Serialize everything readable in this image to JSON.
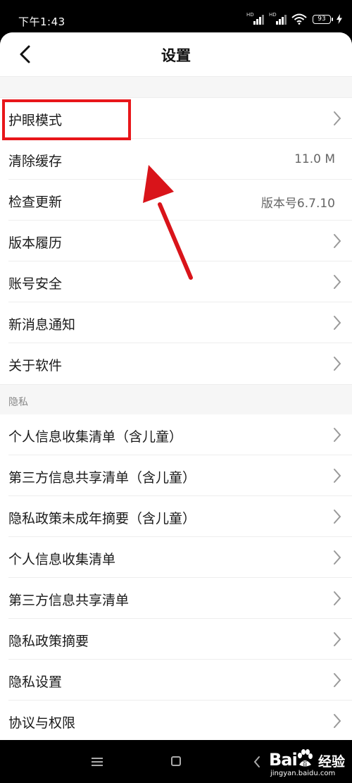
{
  "status_bar": {
    "time": "下午1:43",
    "battery": "93",
    "hd1": "HD",
    "hd2": "HD"
  },
  "header": {
    "title": "设置"
  },
  "settings": [
    {
      "label": "护眼模式",
      "value": ""
    },
    {
      "label": "清除缓存",
      "value": "11.0 M"
    },
    {
      "label": "检查更新",
      "value": "版本号6.7.10"
    },
    {
      "label": "版本履历",
      "value": ""
    },
    {
      "label": "账号安全",
      "value": ""
    },
    {
      "label": "新消息通知",
      "value": ""
    },
    {
      "label": "关于软件",
      "value": ""
    }
  ],
  "privacy": {
    "section_title": "隐私",
    "items": [
      {
        "label": "个人信息收集清单（含儿童）"
      },
      {
        "label": "第三方信息共享清单（含儿童）"
      },
      {
        "label": "隐私政策未成年摘要（含儿童）"
      },
      {
        "label": "个人信息收集清单"
      },
      {
        "label": "第三方信息共享清单"
      },
      {
        "label": "隐私政策摘要"
      },
      {
        "label": "隐私设置"
      },
      {
        "label": "协议与权限"
      }
    ]
  },
  "watermark": {
    "logo_left": "Bai",
    "logo_right": "百",
    "text": "经验",
    "url": "jingyan.baidu.com"
  },
  "colors": {
    "highlight": "#e8161a",
    "arrow": "#d9141a"
  }
}
